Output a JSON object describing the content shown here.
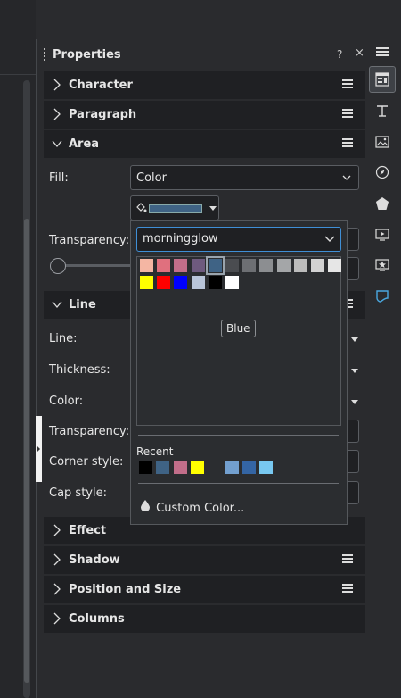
{
  "panel": {
    "title": "Properties",
    "help": "?",
    "close": "×"
  },
  "sections": {
    "character": "Character",
    "paragraph": "Paragraph",
    "area": "Area",
    "line": "Line",
    "effect": "Effect",
    "shadow": "Shadow",
    "position_size": "Position and Size",
    "columns": "Columns"
  },
  "area": {
    "fill_label": "Fill:",
    "fill_value": "Color",
    "fill_color": "#3f6385",
    "transparency_label": "Transparency:"
  },
  "line": {
    "line_label": "Line:",
    "thickness_label": "Thickness:",
    "color_label": "Color:",
    "transparency_label": "Transparency:",
    "corner_label": "Corner style:",
    "cap_label": "Cap style:"
  },
  "color_popup": {
    "palette": "morningglow",
    "palette_colors": [
      "#f4b6a3",
      "#e0707e",
      "#c26e8a",
      "#6e5a7e",
      "#3f6385",
      "#4a4c50",
      "#6d6f73",
      "#8c8e91",
      "#a4a6a8",
      "#bcbcbc",
      "#d2d2d2",
      "#e6e6e6",
      "#ffff00",
      "#ff0000",
      "#0000ff",
      "#b9c5d9",
      "#000000",
      "#ffffff"
    ],
    "selected_color": "Blue",
    "tooltip": "Blue",
    "recent_label": "Recent",
    "recent_colors": [
      "#000000",
      "#3f6385",
      "#c26e8a",
      "#ffff00",
      "#2b2d30",
      "#729fcf",
      "#3465a4",
      "#78c8f0"
    ],
    "custom_color": "Custom Color..."
  },
  "sidebar_tabs": [
    "menu-icon",
    "properties-icon",
    "styles-icon",
    "gallery-icon",
    "navigator-icon",
    "shapes-icon",
    "slide-transition-icon",
    "animation-icon",
    "design-icon"
  ]
}
